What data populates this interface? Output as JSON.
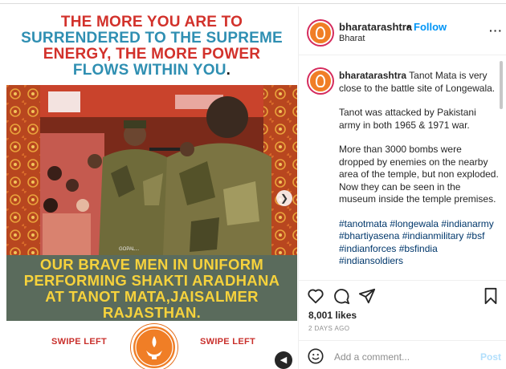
{
  "media": {
    "headline_line1": "THE MORE YOU ARE TO",
    "headline_line2": "SURRENDERED TO THE SUPREME",
    "headline_line3": "ENERGY, THE MORE POWER",
    "headline_line4": "FLOWS WITHIN YOU",
    "headline_period": ".",
    "caption_line1": "OUR BRAVE MEN IN UNIFORM",
    "caption_line2": "PERFORMING SHAKTI ARADHANA",
    "caption_line3": "AT TANOT MATA,JAISALMER",
    "caption_line4": "RAJASTHAN.",
    "swipe_left_label": "SWIPE LEFT",
    "swipe_right_label": "SWIPE LEFT",
    "next_icon": "chevron-right-icon",
    "sound_icon": "speaker-icon"
  },
  "post_header": {
    "username": "bharatarashtra",
    "separator": "•",
    "follow_label": "Follow",
    "location": "Bharat",
    "more_label": "···"
  },
  "comment": {
    "username": "bharatarashtra",
    "para1": "Tanot Mata is very close to the battle site of Longewala.",
    "para2": "Tanot was attacked by Pakistani army in both 1965 & 1971 war.",
    "para3": "More than 3000 bombs were dropped by enemies on the nearby area of the temple, but non exploded. Now they can be seen in the museum inside the temple premises.",
    "hashtags": "#tanotmata #longewala #indianarmy #bhartiyasena #indianmilitary #bsf #indianforces #bsfindia #indiansoldiers"
  },
  "actions": {
    "like_icon": "heart-icon",
    "comment_icon": "comment-icon",
    "share_icon": "share-icon",
    "save_icon": "bookmark-icon",
    "likes": "8,001 likes",
    "time_ago": "2 DAYS AGO"
  },
  "add_comment": {
    "emoji_icon": "emoji-icon",
    "placeholder": "Add a comment...",
    "post_label": "Post"
  },
  "colors": {
    "brand_orange": "#f07e26",
    "follow_blue": "#0095f6",
    "headline_red": "#d2312b",
    "headline_blue": "#2f8fb2",
    "caption_yellow": "#f6d23c",
    "caption_bg": "#5a6b5c"
  }
}
